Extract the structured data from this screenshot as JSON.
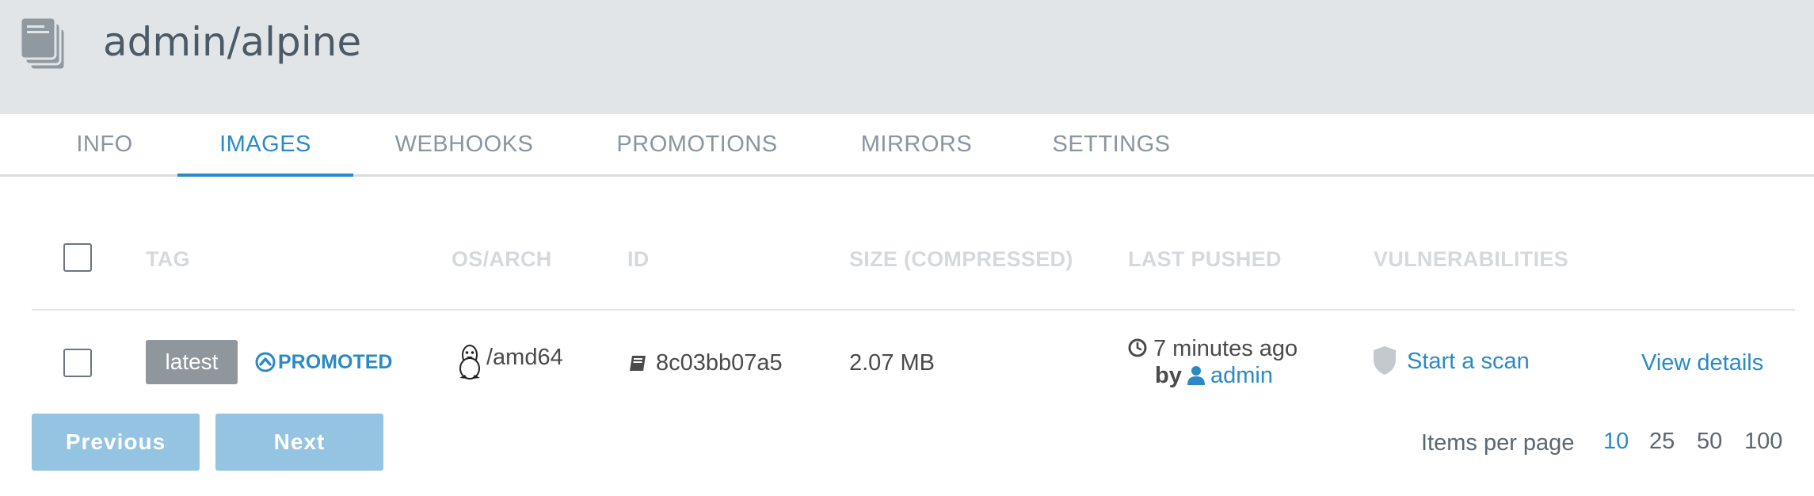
{
  "header": {
    "repo_name": "admin/alpine",
    "icon": "repository-stack-icon"
  },
  "tabs": [
    {
      "label": "INFO",
      "active": false
    },
    {
      "label": "IMAGES",
      "active": true
    },
    {
      "label": "WEBHOOKS",
      "active": false
    },
    {
      "label": "PROMOTIONS",
      "active": false
    },
    {
      "label": "MIRRORS",
      "active": false
    },
    {
      "label": "SETTINGS",
      "active": false
    }
  ],
  "table": {
    "columns": [
      "TAG",
      "OS/ARCH",
      "ID",
      "SIZE (COMPRESSED)",
      "LAST PUSHED",
      "VULNERABILITIES"
    ],
    "rows": [
      {
        "tag": "latest",
        "promoted_label": "PROMOTED",
        "os_arch": "/amd64",
        "os_icon": "linux-tux-icon",
        "id": "8c03bb07a5",
        "size": "2.07 MB",
        "last_pushed": "7 minutes ago",
        "pushed_by_prefix": "by",
        "pushed_by": "admin",
        "vuln_action": "Start a scan",
        "details_link": "View details"
      }
    ]
  },
  "pagination": {
    "previous_label": "Previous",
    "next_label": "Next",
    "items_per_page_label": "Items per page",
    "options": [
      "10",
      "25",
      "50",
      "100"
    ],
    "selected": "10"
  },
  "colors": {
    "accent": "#2b8ac6",
    "header_bg": "#e1e5e8",
    "button_disabled": "#95c4e3"
  }
}
